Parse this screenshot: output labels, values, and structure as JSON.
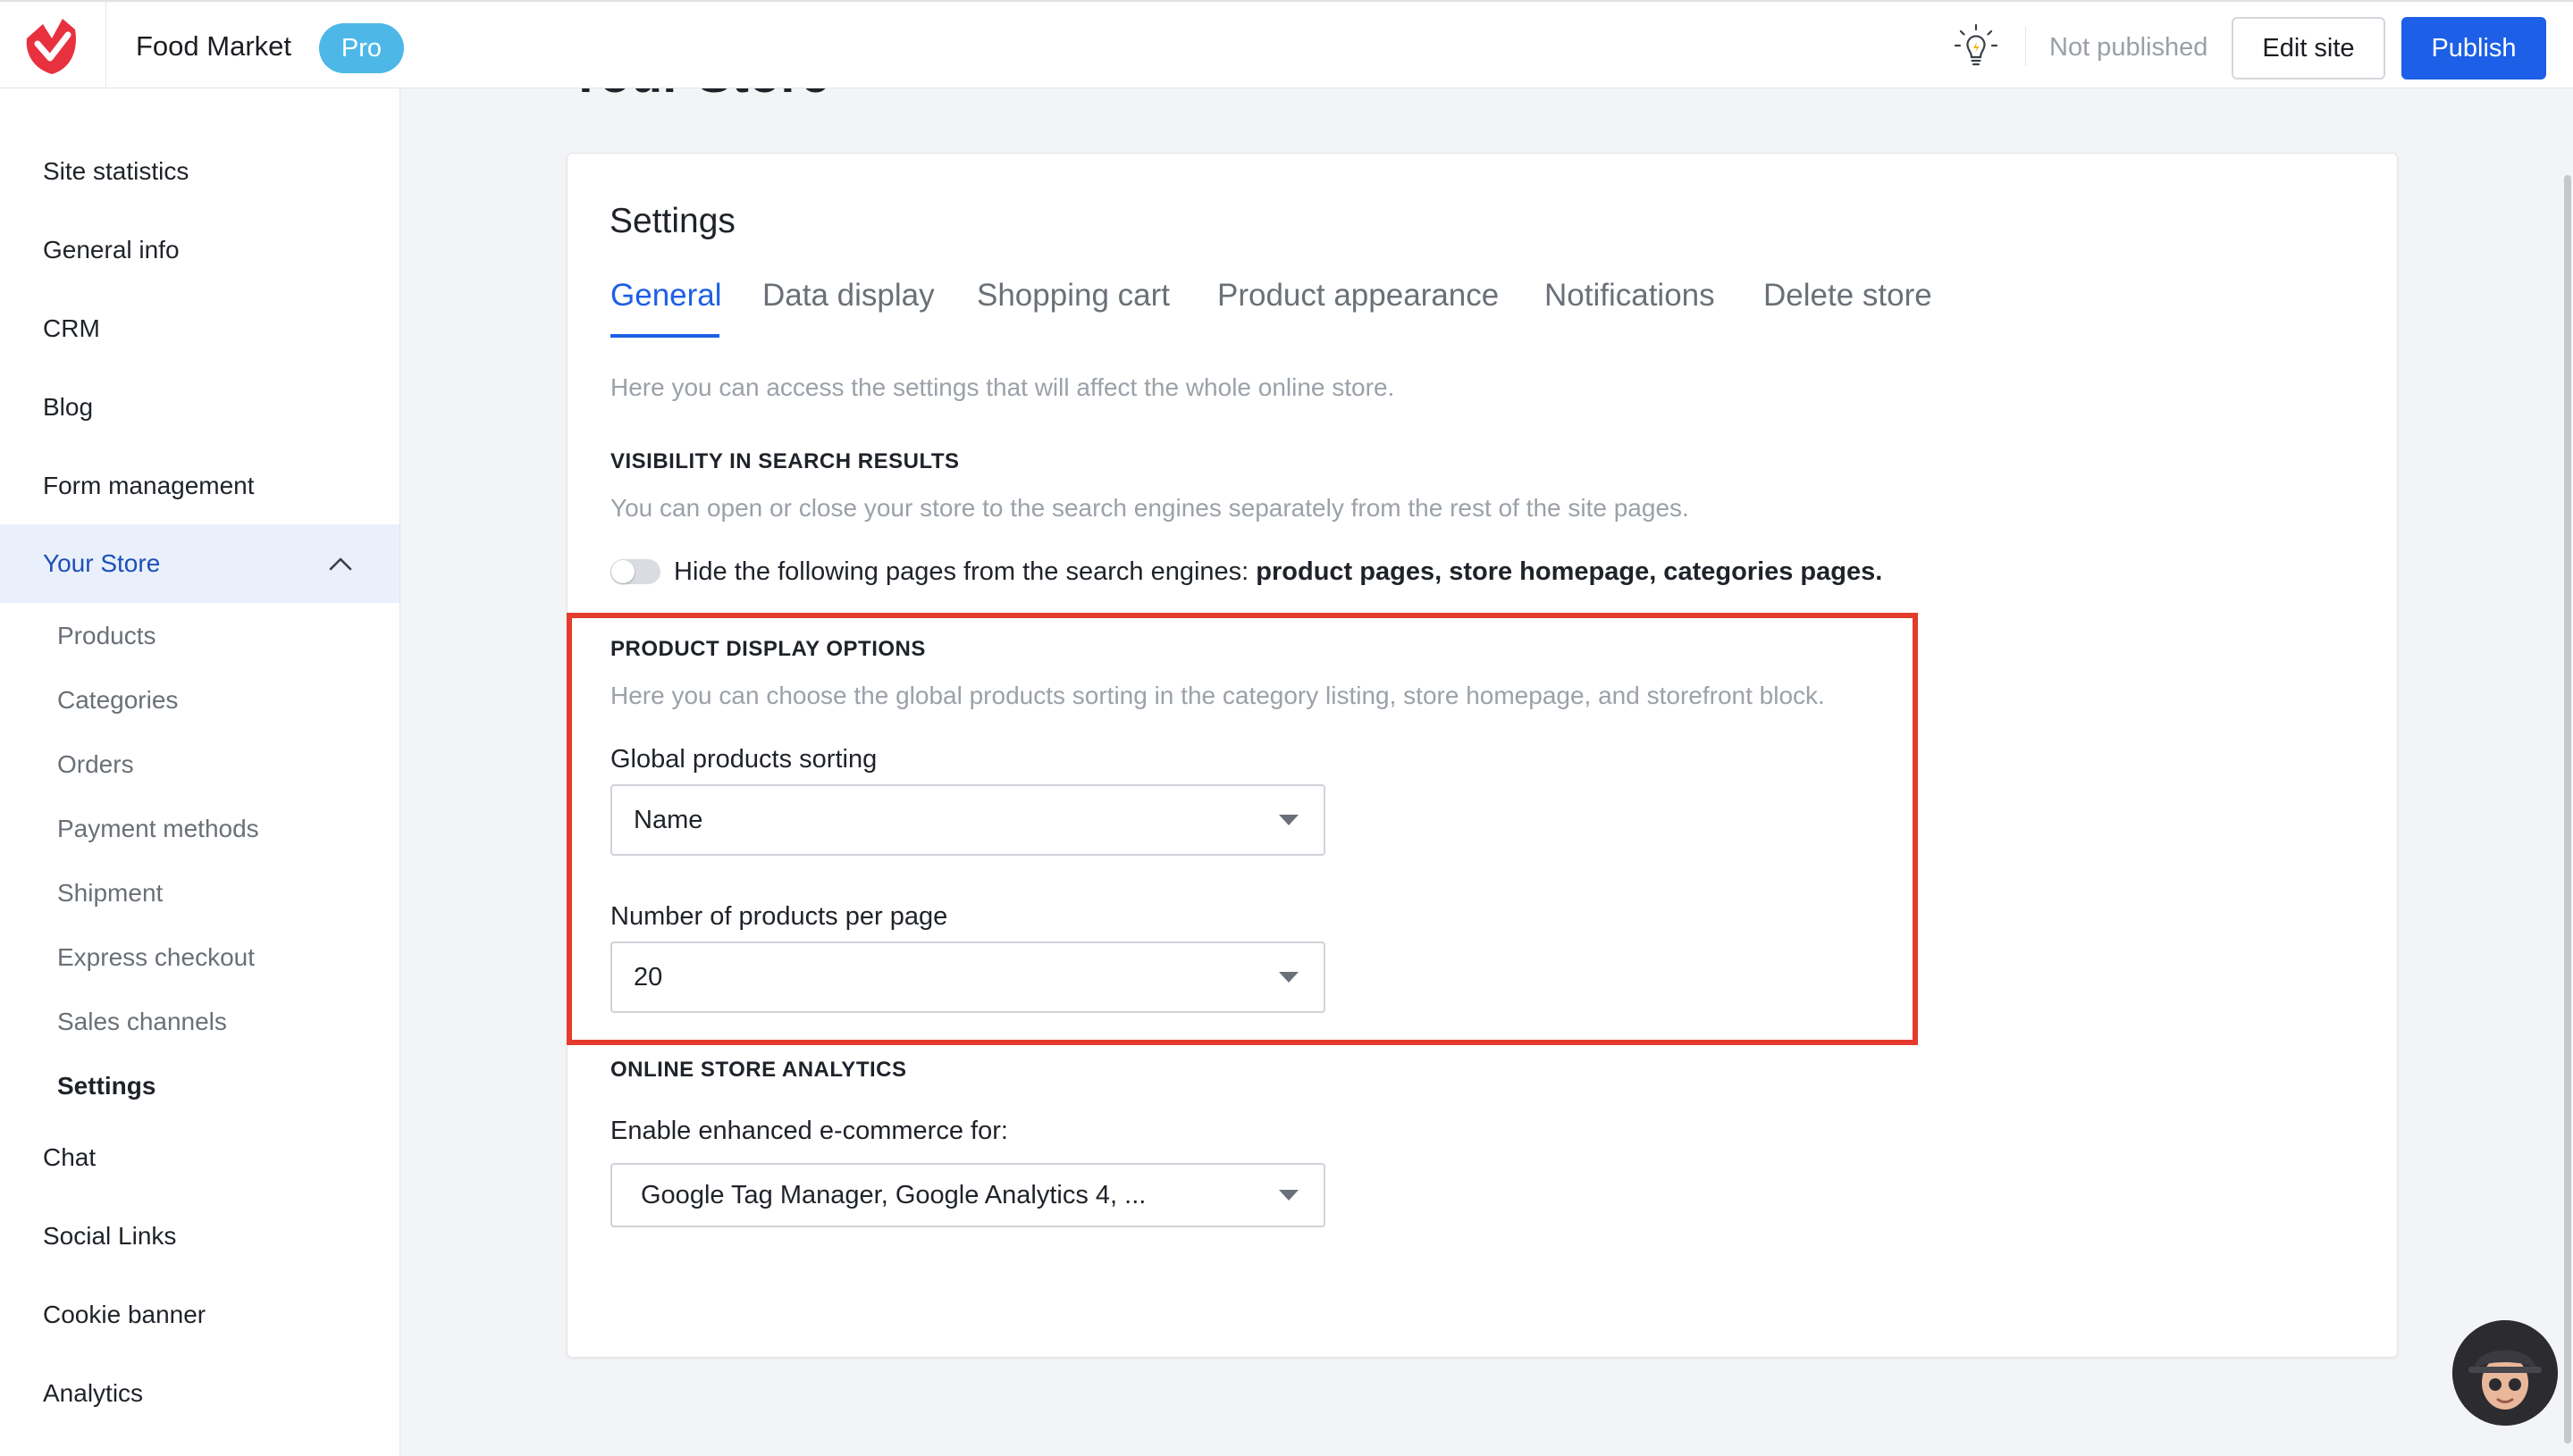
{
  "header": {
    "site_title": "Food Market",
    "plan_badge": "Pro",
    "publish_status": "Not published",
    "edit_site_label": "Edit site",
    "publish_label": "Publish",
    "icons": [
      "brand-logo-icon",
      "lightbulb-icon"
    ]
  },
  "sidebar": {
    "items": [
      {
        "label": "Site statistics"
      },
      {
        "label": "General info"
      },
      {
        "label": "CRM"
      },
      {
        "label": "Blog"
      },
      {
        "label": "Form management"
      },
      {
        "label": "Your Store",
        "active": true,
        "expanded": true
      },
      {
        "label": "Chat"
      },
      {
        "label": "Social Links"
      },
      {
        "label": "Cookie banner"
      },
      {
        "label": "Analytics"
      }
    ],
    "store_subitems": [
      {
        "label": "Products"
      },
      {
        "label": "Categories"
      },
      {
        "label": "Orders"
      },
      {
        "label": "Payment methods"
      },
      {
        "label": "Shipment"
      },
      {
        "label": "Express checkout"
      },
      {
        "label": "Sales channels"
      },
      {
        "label": "Settings",
        "current": true
      }
    ]
  },
  "main": {
    "page_heading": "Your Store",
    "settings_title": "Settings",
    "tabs": [
      {
        "label": "General",
        "active": true
      },
      {
        "label": "Data display"
      },
      {
        "label": "Shopping cart"
      },
      {
        "label": "Product appearance"
      },
      {
        "label": "Notifications"
      },
      {
        "label": "Delete store"
      }
    ],
    "intro": "Here you can access the settings that will affect the whole online store.",
    "visibility": {
      "heading": "VISIBILITY IN SEARCH RESULTS",
      "description": "You can open or close your store to the search engines separately from the rest of the site pages.",
      "toggle_on": false,
      "toggle_text": "Hide the following pages from the search engines:",
      "toggle_pages": "product pages, store homepage, categories pages."
    },
    "product_display": {
      "heading": "PRODUCT DISPLAY OPTIONS",
      "description": "Here you can choose the global products sorting in the category listing, store homepage, and storefront block.",
      "sorting_label": "Global products sorting",
      "sorting_value": "Name",
      "per_page_label": "Number of products per page",
      "per_page_value": "20"
    },
    "analytics": {
      "heading": "ONLINE STORE ANALYTICS",
      "label": "Enable enhanced e-commerce for:",
      "value": "Google Tag Manager, Google Analytics 4, ..."
    }
  },
  "colors": {
    "accent": "#1d5fe6",
    "highlight_border": "#e43b2c",
    "pro_badge": "#4db8e8",
    "brand_logo": "#e8313f"
  }
}
